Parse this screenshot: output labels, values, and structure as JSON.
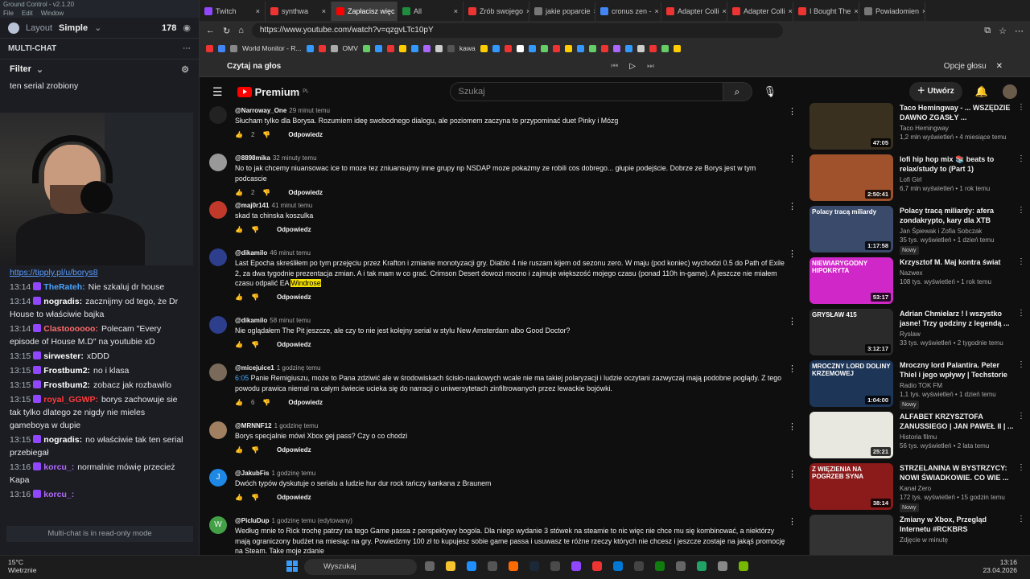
{
  "gc": {
    "title": "Ground Control - v2.1.20",
    "menu": [
      "File",
      "Edit",
      "Window"
    ],
    "layout_label": "Layout",
    "layout_value": "Simple",
    "viewers": "178",
    "multichat": "MULTI-CHAT",
    "filter": "Filter",
    "top_msg": "ten serial zrobiony",
    "tipply": "https://tipply.pl/u/borys8",
    "readonly": "Multi-chat is in read-only mode",
    "messages": [
      {
        "time": "13:14",
        "user": "TheRateh:",
        "color": "#4aa3ff",
        "text": "Nie szkaluj dr house"
      },
      {
        "time": "13:14",
        "user": "nogradis:",
        "color": "#ffffff",
        "text": "zacznijmy od tego, że Dr House to właściwie bajka"
      },
      {
        "time": "13:14",
        "user": "Clastoooooo:",
        "color": "#ff6b6b",
        "text": "Polecam \"Every episode of House M.D\" na youtubie xD"
      },
      {
        "time": "13:15",
        "user": "sirwester:",
        "color": "#ffffff",
        "text": "xDDD"
      },
      {
        "time": "13:15",
        "user": "Frostbum2:",
        "color": "#ffffff",
        "text": "no i klasa"
      },
      {
        "time": "13:15",
        "user": "Frostbum2:",
        "color": "#ffffff",
        "text": "zobacz jak rozbawilo"
      },
      {
        "time": "13:15",
        "user": "royal_GGWP:",
        "color": "#ff3b3b",
        "text": "borys zachowuje sie tak tylko dlatego ze nigdy nie mieles gameboya w dupie"
      },
      {
        "time": "13:15",
        "user": "nogradis:",
        "color": "#ffffff",
        "text": "no właściwie tak ten serial przebiegał"
      },
      {
        "time": "13:16",
        "user": "korcu_:",
        "color": "#b36bff",
        "text": "normalnie mówię przecież Kapa"
      },
      {
        "time": "13:16",
        "user": "korcu_:",
        "color": "#b36bff",
        "text": ""
      }
    ]
  },
  "tabs": [
    {
      "label": "Twitch",
      "color": "#9147ff",
      "active": false
    },
    {
      "label": "synthwa",
      "color": "#e33",
      "active": false
    },
    {
      "label": "Zapłacisz więc",
      "color": "#ff0000",
      "active": true
    },
    {
      "label": "All",
      "color": "#1e8e3e",
      "active": false
    },
    {
      "label": "Zrób swojego",
      "color": "#e33",
      "active": false
    },
    {
      "label": "jakie poparcie",
      "color": "#777",
      "active": false
    },
    {
      "label": "cronus zen -",
      "color": "#4285f4",
      "active": false
    },
    {
      "label": "Adapter Colli",
      "color": "#e33",
      "active": false
    },
    {
      "label": "Adapter Colli",
      "color": "#e33",
      "active": false
    },
    {
      "label": "I Bought The",
      "color": "#e33",
      "active": false
    },
    {
      "label": "Powiadomien",
      "color": "#777",
      "active": false
    }
  ],
  "url": "https://www.youtube.com/watch?v=qzgvLTc10pY",
  "bookmarks": [
    "World Monitor - R...",
    "OMV",
    "kawa"
  ],
  "readaloud": {
    "label": "Czytaj na głos",
    "options": "Opcje głosu"
  },
  "yt": {
    "logo": "Premium",
    "region": "PL",
    "search_placeholder": "Szukaj",
    "create": "Utwórz",
    "comments": [
      {
        "user": "@Narroway_One",
        "time": "29 minut temu",
        "text": "Słucham tylko dla Borysa. Rozumiem ideę swobodnego dialogu, ale poziomem zaczyna to przypominać duet Pinky i Mózg",
        "likes": "2",
        "av": "#222"
      },
      {
        "user": "@8898mika",
        "time": "32 minuty temu",
        "text": "No to jak chcemy niuansowac ice to moze tez zniuansujmy inne grupy np NSDAP moze pokażmy ze robili cos dobrego... głupie podejście. Dobrze ze Borys jest w tym podcascie",
        "likes": "2",
        "av": "#999"
      },
      {
        "user": "@maj0r141",
        "time": "41 minut temu",
        "text": "skad ta chinska koszulka",
        "likes": "",
        "av": "#c0392b"
      },
      {
        "user": "@dikamilo",
        "time": "46 minut temu",
        "text": "Last Epocha skreśliłem po tym przejęciu przez Krafton i zmianie monotyzacji gry. Diablo 4 nie ruszam kijem od sezonu zero. W maju (pod koniec) wychodzi 0.5 do Path of Exile 2, za dwa tygodnie prezentacja zmian. A i tak mam w co grać. Crimson Desert dowozi mocno i zajmuje większość mojego czasu (ponad 110h in-game). A jeszcze nie miałem czasu odpalić EA",
        "highlight": "Windrose",
        "likes": "",
        "av": "#2c3e8c"
      },
      {
        "user": "@dikamilo",
        "time": "58 minut temu",
        "text": "Nie oglądałem The Pit jeszcze, ale czy to nie jest kolejny serial w stylu New Amsterdam albo Good Doctor?",
        "likes": "",
        "av": "#2c3e8c"
      },
      {
        "user": "@micejuice1",
        "time": "1 godzinę temu",
        "ts": "6:05",
        "text": "Panie Remigiuszu, może to Pana zdziwić ale w środowiskach ścisło-naukowych wcale nie ma takiej polaryzacji i ludzie oczytani zazwyczaj mają podobne poglądy. Z tego powodu prawica niemal na całym świecie ucieka się do narracji o uniwersytetach zinfiltrowanych przez lewackie bojówki.",
        "likes": "6",
        "av": "#7a6a5a"
      },
      {
        "user": "@MRNNF12",
        "time": "1 godzinę temu",
        "text": "Borys specjalnie mówi Xbox gej pass? Czy o co chodzi",
        "likes": "",
        "av": "#a08060"
      },
      {
        "user": "@JakubFis",
        "time": "1 godzinę temu",
        "text": "Dwóch typów dyskutuje o serialu a ludzie hur dur rock tańczy kankana z Braunem",
        "likes": "",
        "av": "#1e88e5",
        "initial": "J"
      },
      {
        "user": "@PicluDup",
        "time": "1 godzinę temu (edytowany)",
        "text": "Według mnie to Rick trochę patrzy na tego Game passa z perspektywy bogola. Dla niego wydanie 3 stówek na steamie to nic więc nie chce mu się kombinować, a niektórzy mają ograniczony budżet na miesiąc na gry. Powiedzmy 100 zł to kupujesz sobie game passa i usuwasz te różne rzeczy których nie chcesz i jeszcze zostaje na jakąś promocję na Steam. Take moje zdanie",
        "likes": "",
        "av": "#43a047",
        "initial": "W"
      }
    ],
    "reply": "Odpowiedz",
    "videos": [
      {
        "title": "Taco Hemingway - ... WSZĘDZIE DAWNO ZGASŁY ...",
        "channel": "Taco Hemingway",
        "meta": "1,2 mln wyświetleń • 4 miesiące temu",
        "dur": "47:05",
        "bg": "#3a3020",
        "cap": ""
      },
      {
        "title": "lofi hip hop mix 📚 beats to relax/study to (Part 1)",
        "channel": "Lofi Girl",
        "meta": "6,7 mln wyświetleń • 1 rok temu",
        "dur": "2:50:41",
        "bg": "#a0522d",
        "cap": ""
      },
      {
        "title": "Polacy tracą miliardy: afera zondakrypto, kary dla XTB",
        "channel": "Jan Śpiewak i Zofia Sobczak",
        "meta": "35 tys. wyświetleń • 1 dzień temu",
        "dur": "1:17:58",
        "bg": "#3a4a6a",
        "cap": "Polacy tracą miliardy",
        "new": "Nowy"
      },
      {
        "title": "Krzysztof M. Maj kontra świat",
        "channel": "Nazwex",
        "meta": "108 tys. wyświetleń • 1 rok temu",
        "dur": "53:17",
        "bg": "#d028c8",
        "cap": "NIEWIARYGODNY HIPOKRYTA"
      },
      {
        "title": "Adrian Chmielarz ! I wszystko jasne! Trzy godziny z legendą ...",
        "channel": "Ryslaw",
        "meta": "33 tys. wyświetleń • 2 tygodnie temu",
        "dur": "3:12:17",
        "bg": "#2a2a2a",
        "cap": "GRYSŁAW 415"
      },
      {
        "title": "Mroczny lord Palantira. Peter Thiel i jego wpływy | Techstorie",
        "channel": "Radio TOK FM",
        "meta": "1,1 tys. wyświetleń • 1 dzień temu",
        "dur": "1:04:00",
        "bg": "#1d3557",
        "cap": "MROCZNY LORD DOLINY KRZEMOWEJ",
        "new": "Nowy"
      },
      {
        "title": "ALFABET KRZYSZTOFA ZANUSSIEGO | JAN PAWEŁ II | ...",
        "channel": "Historia filmu",
        "meta": "56 tys. wyświetleń • 2 lata temu",
        "dur": "25:21",
        "bg": "#e8e8e0",
        "cap": ""
      },
      {
        "title": "STRZELANINA W BYSTRZYCY: NOWI ŚWIADKOWIE. CO WIE ...",
        "channel": "Kanał Zero",
        "meta": "172 tys. wyświetleń • 15 godzin temu",
        "dur": "38:14",
        "bg": "#8b1a1a",
        "cap": "Z WIĘZIENIA NA POGRZEB SYNA",
        "new": "Nowy"
      },
      {
        "title": "Zmiany w Xbox, Przegląd Internetu #RCKBRS",
        "channel": "Zdjęcie w minutę",
        "meta": "",
        "dur": "",
        "bg": "#333",
        "cap": ""
      }
    ]
  },
  "taskbar": {
    "temp": "15°C",
    "weather": "Wietrznie",
    "search": "Wyszukaj",
    "time": "13:16",
    "date": "23.04.2026"
  }
}
